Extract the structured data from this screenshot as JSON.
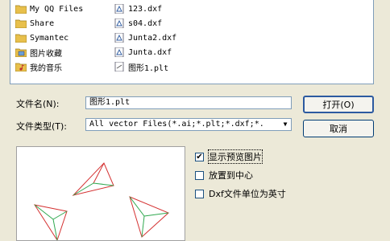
{
  "files": {
    "column1": [
      {
        "name": "My QQ Files",
        "icon": "folder-icon"
      },
      {
        "name": "Share",
        "icon": "folder-icon"
      },
      {
        "name": "Symantec",
        "icon": "folder-icon"
      },
      {
        "name": "图片收藏",
        "icon": "pictures-folder-icon"
      },
      {
        "name": "我的音乐",
        "icon": "music-folder-icon"
      }
    ],
    "column2": [
      {
        "name": "123.dxf",
        "icon": "dxf-file-icon"
      },
      {
        "name": "s04.dxf",
        "icon": "dxf-file-icon"
      },
      {
        "name": "Junta2.dxf",
        "icon": "dxf-file-icon"
      },
      {
        "name": "Junta.dxf",
        "icon": "dxf-file-icon"
      },
      {
        "name": "图形1.plt",
        "icon": "plt-file-icon"
      }
    ]
  },
  "filename": {
    "label": "文件名(N):",
    "value": "图形1.plt"
  },
  "filetype": {
    "label": "文件类型(T):",
    "value": "All vector Files(*.ai;*.plt;*.dxf;*."
  },
  "buttons": {
    "open": "打开(O)",
    "cancel": "取消"
  },
  "options": {
    "show_preview": {
      "label": "显示预览图片",
      "checked": true
    },
    "place_center": {
      "label": "放置到中心",
      "checked": false
    },
    "dxf_inch": {
      "label": "Dxf文件单位为英寸",
      "checked": false
    }
  },
  "colors": {
    "folder": "#e8c04c",
    "accent": "#2c5aa0",
    "preview_red": "#d43030",
    "preview_green": "#2fa84f"
  }
}
